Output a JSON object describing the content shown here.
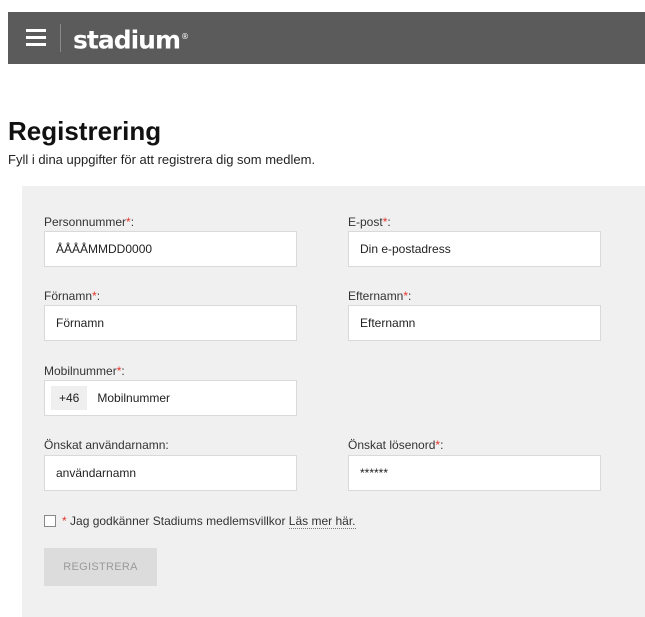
{
  "header": {
    "menu_icon": "hamburger-menu-icon",
    "logo_text": "stadium",
    "logo_mark": "®",
    "background_color": "#5b5b5b"
  },
  "page": {
    "title": "Registrering",
    "subtitle": "Fyll i dina uppgifter för att registrera dig som medlem."
  },
  "form": {
    "required_marker": "*",
    "required_color": "#e4342a",
    "personnummer": {
      "label": "Personnummer",
      "suffix": ":",
      "placeholder": "ÅÅÅÅMMDD0000"
    },
    "email": {
      "label": "E-post",
      "suffix": ":",
      "placeholder": "Din e-postadress"
    },
    "first_name": {
      "label": "Förnamn",
      "suffix": ":",
      "placeholder": "Förnamn"
    },
    "last_name": {
      "label": "Efternamn",
      "suffix": ":",
      "placeholder": "Efternamn"
    },
    "mobile": {
      "label": "Mobilnummer",
      "suffix": ":",
      "country_code": "+46",
      "placeholder": "Mobilnummer"
    },
    "username": {
      "label": "Önskat användarnamn:",
      "placeholder": "användarnamn"
    },
    "password": {
      "label": "Önskat lösenord",
      "suffix": ":",
      "placeholder": "******"
    },
    "terms": {
      "text": "Jag godkänner Stadiums medlemsvillkor",
      "link": "Läs mer här."
    },
    "submit_label": "REGISTRERA"
  }
}
